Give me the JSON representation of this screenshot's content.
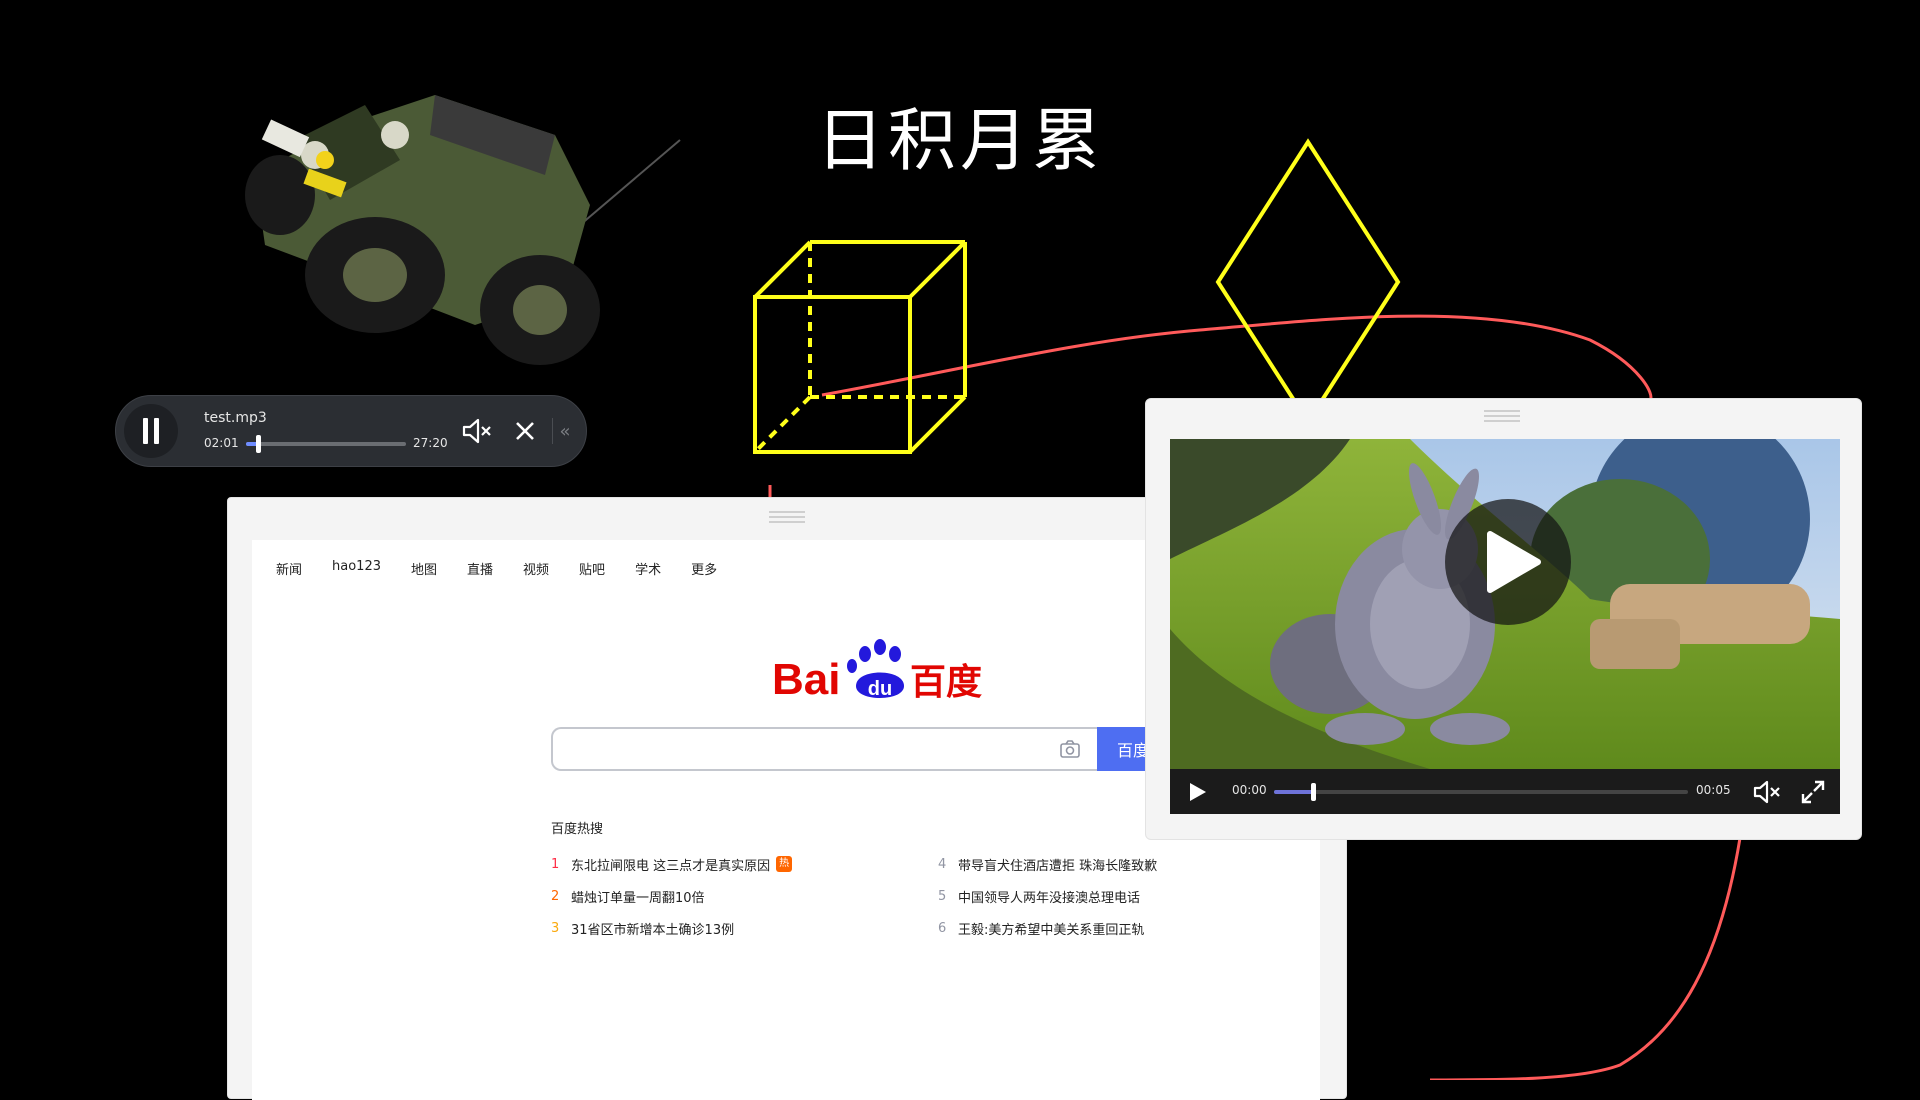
{
  "page": {
    "title": "日积月累"
  },
  "audio_player": {
    "filename": "test.mp3",
    "current_time": "02:01",
    "duration": "27:20",
    "progress": 0.074,
    "collapse_glyph": "«",
    "icons": [
      "pause-icon",
      "volume-mute-icon",
      "close-icon",
      "collapse-icon"
    ]
  },
  "baidu": {
    "nav": [
      "新闻",
      "hao123",
      "地图",
      "直播",
      "视频",
      "贴吧",
      "学术",
      "更多"
    ],
    "logo_latin": "Bai",
    "logo_du": "du",
    "logo_cn": "百度",
    "search": {
      "value": "",
      "placeholder": ""
    },
    "search_button": "百度",
    "hot_title": "百度热搜",
    "hot_left": [
      {
        "rank": "1",
        "text": "东北拉闸限电 这三点才是真实原因",
        "tag": "热",
        "color": "#fe2d46"
      },
      {
        "rank": "2",
        "text": "蜡烛订单量一周翻10倍",
        "tag": "",
        "color": "#ff6600"
      },
      {
        "rank": "3",
        "text": "31省区市新增本土确诊13例",
        "tag": "",
        "color": "#faa90e"
      }
    ],
    "hot_right": [
      {
        "rank": "4",
        "text": "带导盲犬住酒店遭拒 珠海长隆致歉",
        "tag": "",
        "color": "#9195a3"
      },
      {
        "rank": "5",
        "text": "中国领导人两年没接澳总理电话",
        "tag": "",
        "color": "#9195a3"
      },
      {
        "rank": "6",
        "text": "王毅:美方希望中美关系重回正轨",
        "tag": "",
        "color": "#9195a3"
      }
    ]
  },
  "video_player": {
    "current_time": "00:00",
    "duration": "00:05",
    "progress": 0.094,
    "icons": [
      "play-icon",
      "volume-mute-icon",
      "fullscreen-icon",
      "big-play-icon"
    ]
  },
  "colors": {
    "shape_yellow": "#ffff1a",
    "curve_red": "#ff5a5a",
    "baidu_red": "#e10602",
    "baidu_blue": "#2319dc",
    "search_button": "#4e6ef2"
  }
}
